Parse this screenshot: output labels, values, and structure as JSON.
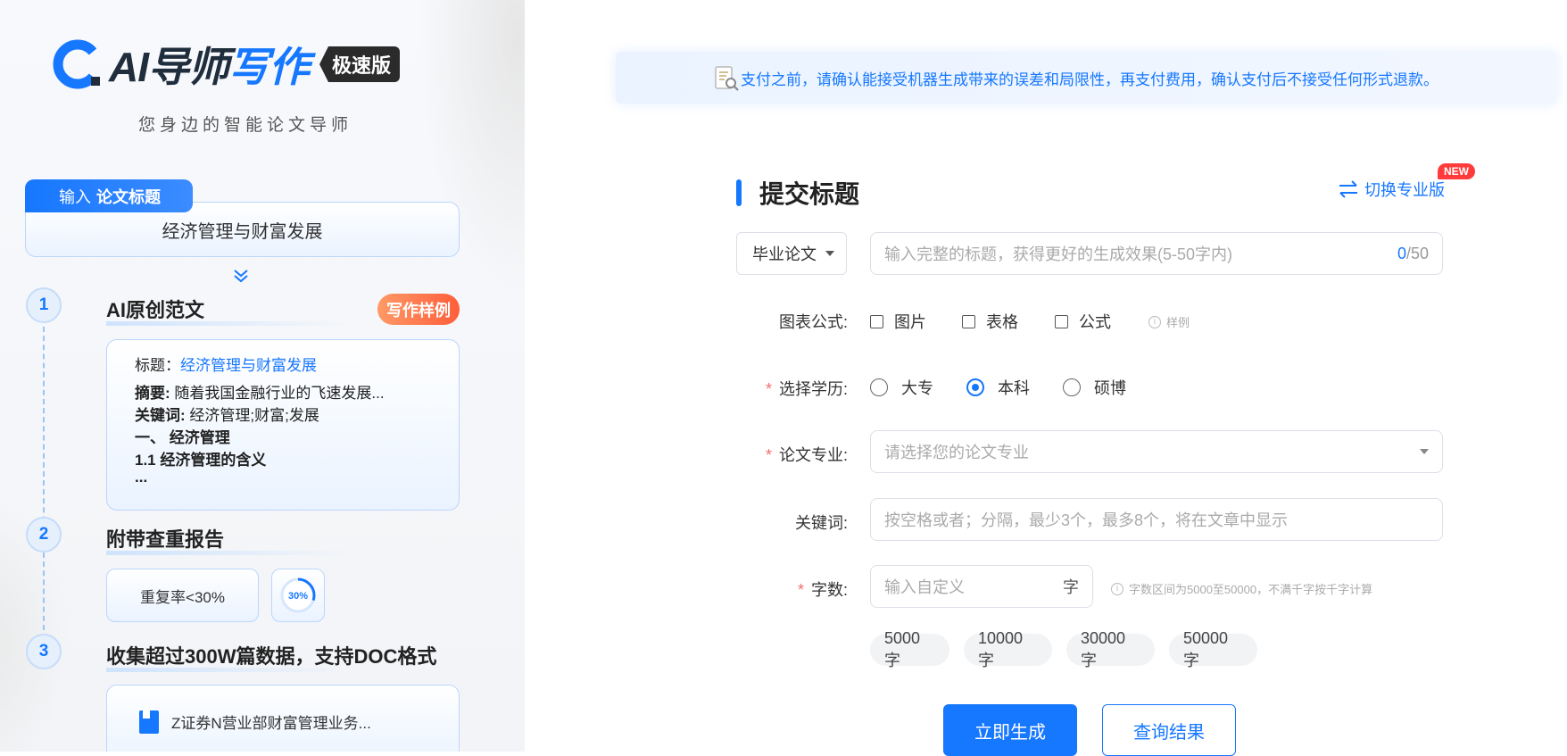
{
  "brand": {
    "logo_text_dark": "AI导师",
    "logo_text_blue": "写作",
    "badge": "极速版",
    "slogan": "您身边的智能论文导师",
    "accent_color": "#1677ff"
  },
  "left": {
    "input_tab_prefix": "输入",
    "input_tab_bold": "论文标题",
    "input_value": "经济管理与财富发展",
    "steps": [
      {
        "num": "1",
        "title": "AI原创范文"
      },
      {
        "num": "2",
        "title": "附带查重报告"
      },
      {
        "num": "3",
        "title": "收集超过300W篇数据，支持DOC格式"
      }
    ],
    "sample_button": "写作样例",
    "sample": {
      "title_label": "标题：",
      "title_value": "经济管理与财富发展",
      "abstract_label": "摘要:",
      "abstract_value": "随着我国金融行业的飞速发展...",
      "keywords_label": "关键词:",
      "keywords_value": "经济管理;财富;发展",
      "heading1": "一、 经济管理",
      "heading2": "1.1 经济管理的含义",
      "ellipsis": "..."
    },
    "dup_rate": "重复率<30%",
    "dup_ring_label": "30%",
    "dup_ring_percent": 30,
    "doc_item": "Z证券N营业部财富管理业务..."
  },
  "notice": {
    "text": "支付之前，请确认能接受机器生成带来的误差和局限性，再支付费用，确认支付后不接受任何形式退款。"
  },
  "form": {
    "section_title": "提交标题",
    "switch_label": "切换专业版",
    "new_badge": "NEW",
    "paper_type": "毕业论文",
    "title_placeholder": "输入完整的标题，获得更好的生成效果(5-50字内)",
    "title_count_current": "0",
    "title_count_max": "/50",
    "chart_label": "图表公式:",
    "chart_options": [
      "图片",
      "表格",
      "公式"
    ],
    "chart_hint": "样例",
    "edu_label": "选择学历:",
    "edu_options": [
      "大专",
      "本科",
      "硕博"
    ],
    "edu_selected": "本科",
    "major_label": "论文专业:",
    "major_placeholder": "请选择您的论文专业",
    "keyword_label": "关键词:",
    "keyword_placeholder": "按空格或者；分隔，最少3个，最多8个，将在文章中显示",
    "words_label": "字数:",
    "words_placeholder": "输入自定义",
    "words_suffix": "字",
    "words_hint": "字数区间为5000至50000，不满千字按千字计算",
    "word_chips": [
      "5000字",
      "10000字",
      "30000字",
      "50000字"
    ],
    "required_mark": "*",
    "generate_button": "立即生成",
    "query_button": "查询结果"
  }
}
